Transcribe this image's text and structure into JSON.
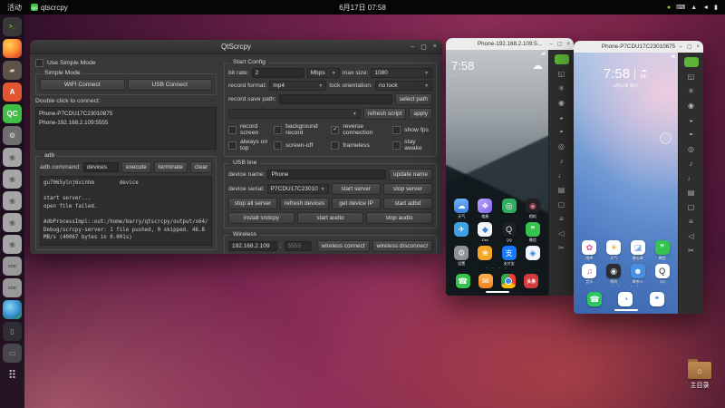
{
  "window_controls": {
    "minimize": "–",
    "maximize": "▢",
    "close": "×"
  },
  "top_bar": {
    "activities": "活动",
    "app_name": "qtscrcpy",
    "clock": "6月17日 07:58",
    "status_icons": [
      {
        "name": "recording-indicator-icon",
        "glyph": "●",
        "color": "#79d03f"
      },
      {
        "name": "input-method-icon",
        "glyph": "⌨",
        "color": "#d8d8d8"
      },
      {
        "name": "network-icon",
        "glyph": "▲",
        "color": "#d8d8d8"
      },
      {
        "name": "volume-icon",
        "glyph": "◄",
        "color": "#d8d8d8"
      },
      {
        "name": "battery-icon",
        "glyph": "▮",
        "color": "#d8d8d8"
      }
    ]
  },
  "dock": {
    "items": [
      {
        "name": "dock-terminal",
        "bg": "#383838",
        "glyph": ">_",
        "color": "#7ad83a",
        "dot": "•"
      },
      {
        "name": "dock-firefox",
        "bg": "radial-gradient(circle at 35% 30%, #ffd54f, #ff9435 45%, #e2512b 80%, #a32b16)",
        "glyph": "",
        "color": "#fff",
        "dot": "•"
      },
      {
        "name": "dock-files",
        "bg": "#5c5248",
        "glyph": "▰",
        "color": "#d8c9b5",
        "dot": "•"
      },
      {
        "name": "dock-ubuntu-software",
        "bg": "#e2572f",
        "glyph": "A",
        "color": "#fff",
        "dot": ""
      },
      {
        "name": "dock-qtscrcpy",
        "bg": "#3fbf45",
        "glyph": "QC",
        "color": "#fff",
        "dot": "•"
      },
      {
        "name": "dock-settings",
        "bg": "#6e6e6e",
        "glyph": "⚙",
        "color": "#e2e2e2",
        "dot": ""
      },
      {
        "name": "dock-drive-1",
        "bg": "#a6a6a6",
        "glyph": "◉",
        "color": "#5f5f5f",
        "dot": ""
      },
      {
        "name": "dock-drive-2",
        "bg": "#a6a6a6",
        "glyph": "◉",
        "color": "#5f5f5f",
        "dot": ""
      },
      {
        "name": "dock-drive-3",
        "bg": "#a6a6a6",
        "glyph": "◉",
        "color": "#5f5f5f",
        "dot": ""
      },
      {
        "name": "dock-drive-4",
        "bg": "#a6a6a6",
        "glyph": "◉",
        "color": "#5f5f5f",
        "dot": ""
      },
      {
        "name": "dock-drive-5",
        "bg": "#a6a6a6",
        "glyph": "◉",
        "color": "#5f5f5f",
        "dot": ""
      },
      {
        "name": "dock-ssd-1",
        "bg": "#999999",
        "glyph": "SSD",
        "color": "#4a4a4a",
        "dot": ""
      },
      {
        "name": "dock-ssd-2",
        "bg": "#999999",
        "glyph": "SSD",
        "color": "#4a4a4a",
        "dot": ""
      },
      {
        "name": "dock-globe",
        "bg": "radial-gradient(circle at 38% 35%, #8fd4ef, #3f9edd 45%, #2e7fae 65%, #2aa45c 90%)",
        "glyph": "",
        "color": "#fff",
        "dot": ""
      },
      {
        "name": "dock-phone-mirror",
        "bg": "#2e2e34",
        "glyph": "▯",
        "color": "#9a9a9a",
        "dot": ""
      },
      {
        "name": "dock-drive-dark",
        "bg": "#46464c",
        "glyph": "▭",
        "color": "#9a9a9a",
        "dot": ""
      },
      {
        "name": "dock-show-apps",
        "bg": "transparent",
        "glyph": "⠿",
        "color": "#d8d8d8",
        "dot": ""
      }
    ]
  },
  "desktop": {
    "home_folder_label": "主目录"
  },
  "main_window": {
    "title": "QtScrcpy",
    "left": {
      "use_simple_mode": "Use Simple Mode",
      "simple_mode_group": "Simple Mode",
      "wifi_connect": "WIFI Connect",
      "usb_connect": "USB Connect",
      "double_click_label": "Double click to connect:",
      "devices": [
        {
          "name": "device-item",
          "label": "Phone-P7CDU17C23010875"
        },
        {
          "name": "device-item",
          "label": "Phone-192.168.2.109:5555"
        }
      ],
      "adb_group": "adb",
      "adb_command_label": "adb command:",
      "adb_command_value": "devices",
      "execute": "execute",
      "terminate": "terminate",
      "clear": "clear",
      "console": "gu7065ylnj6xinhm        device\n\nstart server...\nopen file failed.\n\nAdbProcessImpl::out:/home/barry/qtscrcpy/output/x64/\nDebug/scrcpy-server: 1 file pushed, 0 skipped. 46.8 MB/s (40067 bytes in 0.001s)"
    },
    "right": {
      "start_config_group": "Start Config",
      "bit_rate_label": "bit rate:",
      "bit_rate_value": "2",
      "bit_rate_unit": "Mbps",
      "max_size_label": "max size:",
      "max_size_value": "1080",
      "record_format_label": "record format:",
      "record_format_value": "mp4",
      "lock_orientation_label": "lock orientation:",
      "lock_orientation_value": "no lock",
      "record_save_path_label": "record save path:",
      "record_save_path_value": "",
      "select_path": "select path",
      "script_value": "",
      "refresh_script": "refresh script",
      "apply": "apply",
      "checkboxes": [
        {
          "name": "cb-record-screen",
          "label": "record screen",
          "mark": ""
        },
        {
          "name": "cb-background-record",
          "label": "background record",
          "mark": ""
        },
        {
          "name": "cb-reverse-connection",
          "label": "reverse connection",
          "mark": "✓"
        },
        {
          "name": "cb-show-fps",
          "label": "show fps",
          "mark": ""
        },
        {
          "name": "cb-always-on-top",
          "label": "always on top",
          "mark": ""
        },
        {
          "name": "cb-screen-off",
          "label": "screen-off",
          "mark": ""
        },
        {
          "name": "cb-frameless",
          "label": "frameless",
          "mark": ""
        },
        {
          "name": "cb-stay-awake",
          "label": "stay awake",
          "mark": ""
        }
      ],
      "usb_line_group": "USB line",
      "device_name_label": "device name:",
      "device_name_value": "Phone",
      "update_name": "update name",
      "device_serial_label": "device serial:",
      "device_serial_value": "P7CDU17C23010",
      "start_server": "start server",
      "stop_server": "stop server",
      "stop_all_server": "stop all server",
      "refresh_devices": "refresh devices",
      "get_device_ip": "get device IP",
      "start_adbd": "start adbd",
      "install_sndcpy": "install sndcpy",
      "start_audio": "start audio",
      "stop_audio": "stop audio",
      "wireless_group": "Wireless",
      "ip_value": "192.168.2.109",
      "port_sep": ":",
      "port_placeholder": "5555",
      "wireless_connect": "wireless connect",
      "wireless_disconnect": "wireless disconnect"
    }
  },
  "phone_toolbar": {
    "icons": [
      {
        "name": "expand-button",
        "glyph": "",
        "bg": "#5cb337"
      },
      {
        "name": "fullscreen-icon",
        "glyph": "◱",
        "bg": ""
      },
      {
        "name": "notification-icon",
        "glyph": "✳",
        "bg": ""
      },
      {
        "name": "touch-icon",
        "glyph": "◉",
        "bg": ""
      },
      {
        "name": "screen-off-icon",
        "glyph": "◒",
        "bg": ""
      },
      {
        "name": "screen-on-icon",
        "glyph": "◓",
        "bg": ""
      },
      {
        "name": "power-icon",
        "glyph": "◎",
        "bg": ""
      },
      {
        "name": "volume-up-icon",
        "glyph": "♪",
        "bg": ""
      },
      {
        "name": "volume-down-icon",
        "glyph": "♩",
        "bg": ""
      },
      {
        "name": "app-switch-icon",
        "glyph": "▤",
        "bg": ""
      },
      {
        "name": "home-icon",
        "glyph": "▢",
        "bg": ""
      },
      {
        "name": "menu-icon",
        "glyph": "≡",
        "bg": ""
      },
      {
        "name": "back-icon",
        "glyph": "◁",
        "bg": ""
      },
      {
        "name": "screenshot-icon",
        "glyph": "✂",
        "bg": ""
      }
    ]
  },
  "phone1": {
    "title": "Phone-192.168.2.109:5...",
    "status_left": "·····",
    "status_right": "◢▮",
    "time": "7:58",
    "time_sub": "·····",
    "cloud_glyph": "☁",
    "page_dots": "· · · ·",
    "apps": [
      {
        "name": "app-weather",
        "bg": "linear-gradient(180deg,#6fb1f5,#3d7fe0)",
        "glyph": "☁",
        "color": "#fff",
        "label": "天气"
      },
      {
        "name": "app-gallery",
        "bg": "linear-gradient(135deg,#b9a6f7,#7f63ee)",
        "glyph": "❖",
        "color": "#fff",
        "label": "相册"
      },
      {
        "name": "app-green",
        "bg": "#2fae5f",
        "glyph": "◎",
        "color": "#fff",
        "label": ""
      },
      {
        "name": "app-camera",
        "bg": "#241f22",
        "glyph": "◉",
        "color": "#d8737f",
        "label": "相机"
      },
      {
        "name": "app-telegram",
        "bg": "#3ca2e0",
        "glyph": "✈",
        "color": "#fff",
        "label": ""
      },
      {
        "name": "app-dev",
        "bg": "#f2f4f7",
        "glyph": "◆",
        "color": "#3b82d8",
        "label": "Dev"
      },
      {
        "name": "app-qq",
        "bg": "#1d1f27",
        "glyph": "Q",
        "color": "#e8e8e8",
        "label": "QQ"
      },
      {
        "name": "app-wechat",
        "bg": "#35c24d",
        "glyph": "❞",
        "color": "#fff",
        "label": "微信"
      },
      {
        "name": "app-settings",
        "bg": "#8e9399",
        "glyph": "⚙",
        "color": "#f0f0f0",
        "label": "设置"
      },
      {
        "name": "app-orange",
        "bg": "#f5a623",
        "glyph": "❀",
        "color": "#fff7d6",
        "label": ""
      },
      {
        "name": "app-alipay",
        "bg": "#1678ff",
        "glyph": "支",
        "color": "#fff",
        "label": "支付宝"
      },
      {
        "name": "app-blue",
        "bg": "#eef3fa",
        "glyph": "◈",
        "color": "#2d7fe8",
        "label": ""
      }
    ],
    "dock": [
      {
        "name": "app-phone",
        "bg": "#35c24d",
        "glyph": "☎",
        "color": "#fff"
      },
      {
        "name": "app-messages",
        "bg": "linear-gradient(180deg,#ffb14d,#f58220)",
        "glyph": "✉",
        "color": "#fff"
      },
      {
        "name": "app-chrome",
        "bg": "radial-gradient(circle at 50% 50%, #4285f4 26%, #ffffff 26% 34%, rgba(0,0,0,0) 34%), conic-gradient(#ea4335 0deg 120deg, #fbbc05 120deg 240deg, #34a853 240deg 360deg)",
        "glyph": "",
        "color": "#fff"
      },
      {
        "name": "app-toutiao",
        "bg": "#d43d3d",
        "glyph": "头条",
        "color": "#fff"
      }
    ]
  },
  "phone2": {
    "title": "Phone-P7CDU17C23010875",
    "status_left": "·····",
    "status_right": "◢▮",
    "time": "7:58",
    "weather_glyph": "☁",
    "temp": "24°",
    "date": "6月17日 周六",
    "page_dots": "· · · · ·",
    "apps": [
      {
        "name": "app-gallery2",
        "bg": "#ffffff",
        "glyph": "✿",
        "color": "#e0508a",
        "label": "图库"
      },
      {
        "name": "app-weather2",
        "bg": "#ffffff",
        "glyph": "☀",
        "color": "#f5a623",
        "label": "天气"
      },
      {
        "name": "app-notes",
        "bg": "#ffffff",
        "glyph": "◪",
        "color": "#8aa8e8",
        "label": "备忘录"
      },
      {
        "name": "app-wechat2",
        "bg": "#35c24d",
        "glyph": "❞",
        "color": "#fff",
        "label": "微信"
      },
      {
        "name": "app-music",
        "bg": "#ffffff",
        "glyph": "♫",
        "color": "#e0508a",
        "label": "音乐"
      },
      {
        "name": "app-camera2",
        "bg": "#2a2d33",
        "glyph": "◉",
        "color": "#dfe3e8",
        "label": "相机"
      },
      {
        "name": "app-contacts",
        "bg": "#4a90e2",
        "glyph": "☻",
        "color": "#fff",
        "label": "联系人"
      },
      {
        "name": "app-qq2",
        "bg": "#ffffff",
        "glyph": "Q",
        "color": "#1d1f27",
        "label": "QQ"
      }
    ],
    "dock": [
      {
        "name": "app-phone2",
        "bg": "#2ec562",
        "glyph": "☎",
        "color": "#fff"
      },
      {
        "name": "app-browser2",
        "bg": "#ffffff",
        "glyph": "◔",
        "color": "#2d7fe8"
      },
      {
        "name": "app-messages2",
        "bg": "#ffffff",
        "glyph": "❝",
        "color": "#2d7fe8"
      }
    ]
  }
}
